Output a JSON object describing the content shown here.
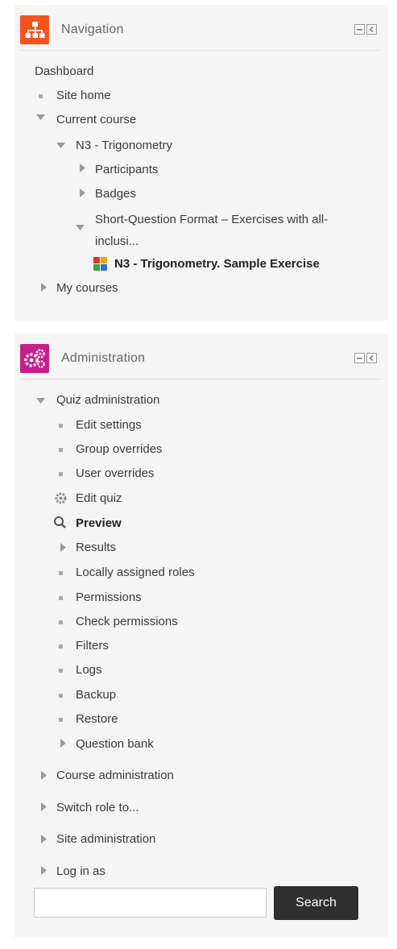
{
  "navigation": {
    "title": "Navigation",
    "icon": "sitemap-icon",
    "accent": "#f4541d",
    "items": {
      "dashboard": "Dashboard",
      "site_home": "Site home",
      "current_course": "Current course",
      "course": "N3 - Trigonometry",
      "participants": "Participants",
      "badges": "Badges",
      "section_line1": "Short-Question Format – Exercises with all-",
      "section_line2": "inclusi...",
      "quiz": "N3 - Trigonometry. Sample Exercise",
      "my_courses": "My courses"
    }
  },
  "administration": {
    "title": "Administration",
    "icon": "gears-icon",
    "accent": "#c4208a",
    "items": {
      "quiz_admin": "Quiz administration",
      "edit_settings": "Edit settings",
      "group_overrides": "Group overrides",
      "user_overrides": "User overrides",
      "edit_quiz": "Edit quiz",
      "preview": "Preview",
      "results": "Results",
      "local_roles": "Locally assigned roles",
      "permissions": "Permissions",
      "check_permissions": "Check permissions",
      "filters": "Filters",
      "logs": "Logs",
      "backup": "Backup",
      "restore": "Restore",
      "question_bank": "Question bank",
      "course_admin": "Course administration",
      "switch_role": "Switch role to...",
      "site_admin": "Site administration",
      "log_in_as": "Log in as"
    },
    "search": {
      "value": "",
      "button_label": "Search"
    }
  }
}
